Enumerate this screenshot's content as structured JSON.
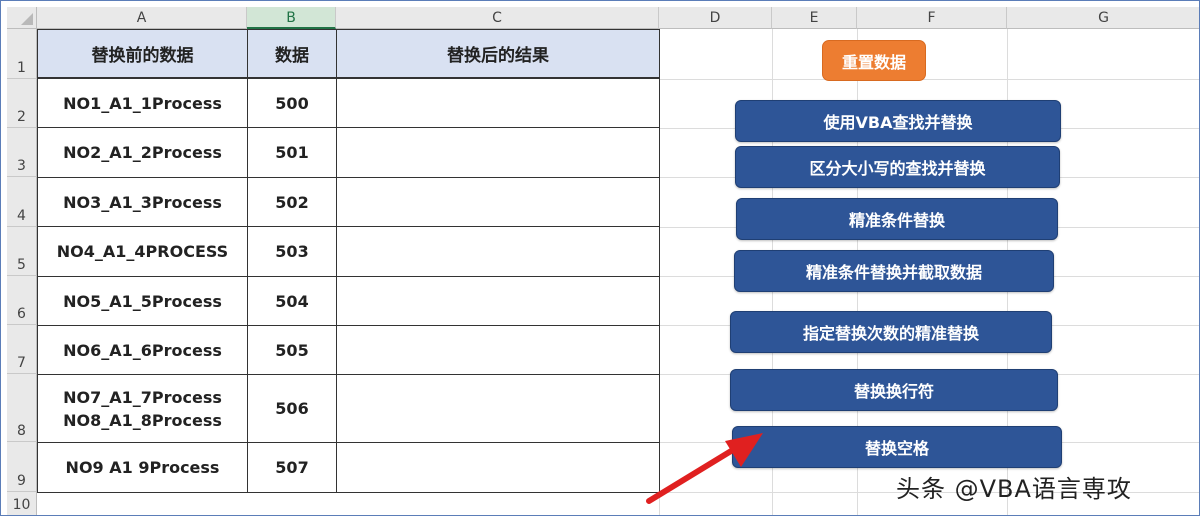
{
  "columns": [
    "A",
    "B",
    "C",
    "D",
    "E",
    "F",
    "G"
  ],
  "rows": [
    "1",
    "2",
    "3",
    "4",
    "5",
    "6",
    "7",
    "8",
    "9",
    "10"
  ],
  "table": {
    "headers": [
      "替换前的数据",
      "数据",
      "替换后的结果"
    ],
    "rows": [
      {
        "before": "NO1_A1_1Process",
        "value": "500",
        "after": ""
      },
      {
        "before": "NO2_A1_2Process",
        "value": "501",
        "after": ""
      },
      {
        "before": "NO3_A1_3Process",
        "value": "502",
        "after": ""
      },
      {
        "before": "NO4_A1_4PROCESS",
        "value": "503",
        "after": ""
      },
      {
        "before": "NO5_A1_5Process",
        "value": "504",
        "after": ""
      },
      {
        "before": "NO6_A1_6Process",
        "value": "505",
        "after": ""
      },
      {
        "before": "NO7_A1_7Process\nNO8_A1_8Process",
        "value": "506",
        "after": ""
      },
      {
        "before": "NO9 A1 9Process",
        "value": "507",
        "after": ""
      }
    ]
  },
  "buttons": {
    "reset": "重置数据",
    "vba_replace": "使用VBA查找并替换",
    "case_replace": "区分大小写的查找并替换",
    "exact_replace": "精准条件替换",
    "exact_replace_extract": "精准条件替换并截取数据",
    "count_replace": "指定替换次数的精准替换",
    "newline_replace": "替换换行符",
    "space_replace": "替换空格"
  },
  "watermark": "头条 @VBA语言専攻",
  "colors": {
    "header_fill": "#d9e1f2",
    "reset_button": "#ed7d31",
    "macro_button": "#2e5597",
    "arrow": "#e02020"
  },
  "selected_column": "B"
}
